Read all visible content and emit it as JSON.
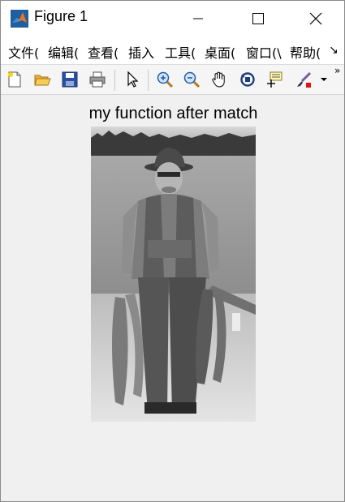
{
  "window": {
    "title": "Figure 1"
  },
  "menu": {
    "items": [
      "文件(",
      "编辑(",
      "查看(",
      "插入",
      "工具(",
      "桌面(",
      "窗口(\\",
      "帮助("
    ],
    "overflow_glyph": "↘"
  },
  "toolbar": {
    "tools": [
      "new-figure-icon",
      "open-file-icon",
      "save-icon",
      "print-icon",
      "select-pointer-icon",
      "zoom-in-icon",
      "zoom-out-icon",
      "pan-hand-icon",
      "rotate-3d-icon",
      "data-cursor-icon",
      "brush-icon",
      "brush-dropdown-icon"
    ],
    "overflow_glyph": "»"
  },
  "figure": {
    "axes_title": "my function after match",
    "image_description_icon": "grayscale-photo-man-with-fish"
  }
}
